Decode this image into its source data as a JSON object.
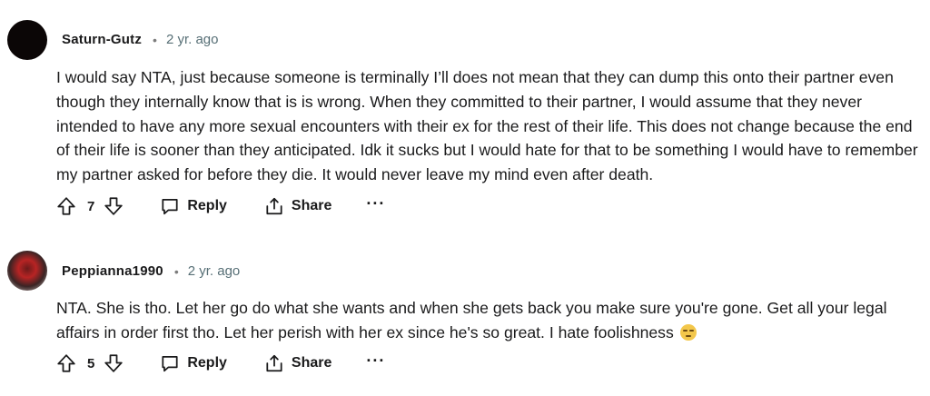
{
  "comments": [
    {
      "username": "Saturn-Gutz",
      "separator": "•",
      "time": "2 yr. ago",
      "body": "I would say NTA, just because someone is terminally I’ll does not mean that they can dump this onto their partner even though they internally know that is is wrong. When they committed to their partner, I would assume that they never intended to have any more sexual encounters with their ex for the rest of their life. This does not change because the end of their life is sooner than they anticipated. Idk it sucks but I would hate for that to be something I would have to remember my partner asked for before they die. It would never leave my mind even after death.",
      "score": "7",
      "reply_label": "Reply",
      "share_label": "Share",
      "more_label": "···",
      "avatar_icon": "user-avatar"
    },
    {
      "username": "Peppianna1990",
      "separator": "•",
      "time": "2 yr. ago",
      "body": "NTA. She is tho. Let her go do what she wants and when she gets back you make sure you're gone. Get all your legal affairs in order first tho. Let her perish with her ex since he's so great. I hate foolishness",
      "emoji": "pensive-face-emoji",
      "score": "5",
      "reply_label": "Reply",
      "share_label": "Share",
      "more_label": "···",
      "avatar_icon": "user-avatar"
    }
  ],
  "icons": {
    "upvote": "upvote-arrow-icon",
    "downvote": "downvote-arrow-icon",
    "reply": "speech-bubble-icon",
    "share": "share-upload-icon"
  },
  "colors": {
    "text": "#1a1a1b",
    "meta": "#576f76",
    "background": "#ffffff"
  }
}
